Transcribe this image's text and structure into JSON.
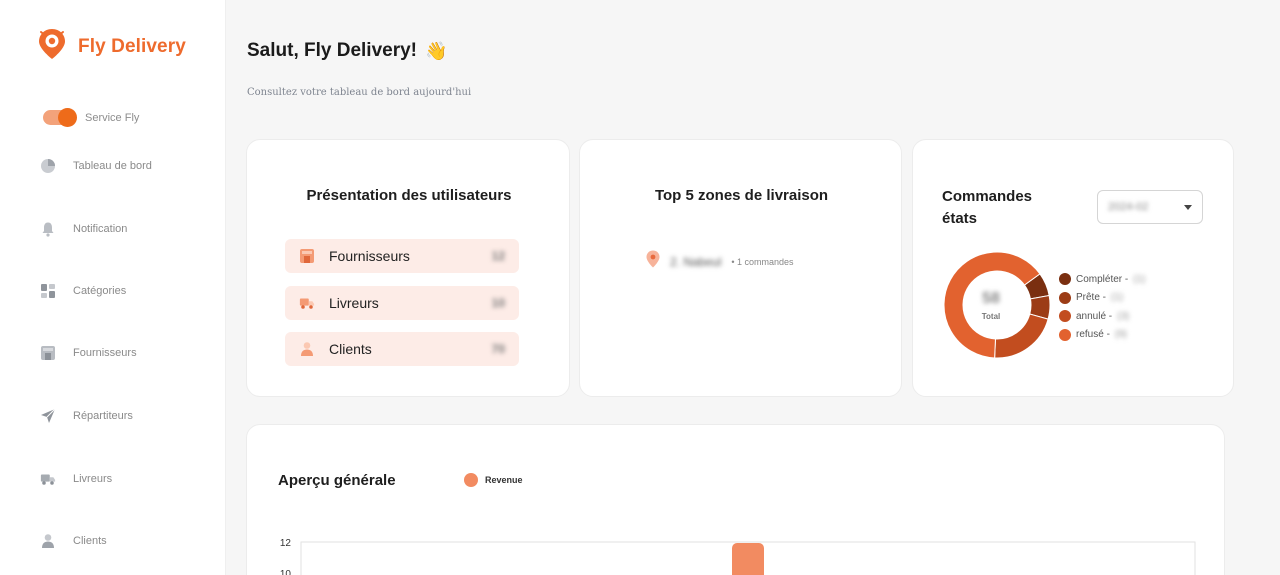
{
  "brand": {
    "name": "Fly Delivery",
    "color": "#ee6b2d",
    "icon": "location-pin-logo-icon"
  },
  "sidebar": {
    "toggle_label": "Service Fly",
    "items": [
      {
        "label": "Tableau de bord",
        "icon": "pie-chart-icon"
      },
      {
        "label": "Notification",
        "icon": "bell-icon"
      },
      {
        "label": "Catégories",
        "icon": "grid-icon"
      },
      {
        "label": "Fournisseurs",
        "icon": "store-icon"
      },
      {
        "label": "Répartiteurs",
        "icon": "paper-plane-icon"
      },
      {
        "label": "Livreurs",
        "icon": "truck-icon"
      },
      {
        "label": "Clients",
        "icon": "user-icon"
      }
    ]
  },
  "header": {
    "greeting": "Salut, Fly Delivery!",
    "wave": "👋",
    "subtitle": "Consultez votre tableau de bord aujourd'hui"
  },
  "users_card": {
    "title": "Présentation des utilisateurs",
    "rows": [
      {
        "label": "Fournisseurs",
        "count": "12",
        "icon": "store-icon"
      },
      {
        "label": "Livreurs",
        "count": "10",
        "icon": "truck-icon"
      },
      {
        "label": "Clients",
        "count": "70",
        "icon": "user-icon"
      }
    ]
  },
  "zones_card": {
    "title": "Top 5 zones de livraison",
    "zones": [
      {
        "name": "2. Nabeul",
        "count": "• 1 commandes"
      }
    ]
  },
  "orders_card": {
    "title_line1": "Commandes",
    "title_line2": "états",
    "select_value": "2024-02",
    "total_value": "58",
    "total_label": "Total",
    "legend": [
      {
        "label": "Compléter - ",
        "value": "(1)",
        "color": "#7a2f10"
      },
      {
        "label": "Prête - ",
        "value": "(1)",
        "color": "#9c3c16"
      },
      {
        "label": "annulé - ",
        "value": "(3)",
        "color": "#c24d1f"
      },
      {
        "label": "refusé - ",
        "value": "(9)",
        "color": "#e2622f"
      }
    ]
  },
  "overview_card": {
    "title": "Aperçu générale",
    "legend_label": "Revenue",
    "legend_color": "#f28b61"
  },
  "chart_data": {
    "type": "bar",
    "series": [
      {
        "name": "Revenue",
        "color": "#f28b61"
      }
    ],
    "y_ticks": [
      "12",
      "10"
    ],
    "ylim": [
      0,
      12
    ],
    "bar_value": 12
  }
}
